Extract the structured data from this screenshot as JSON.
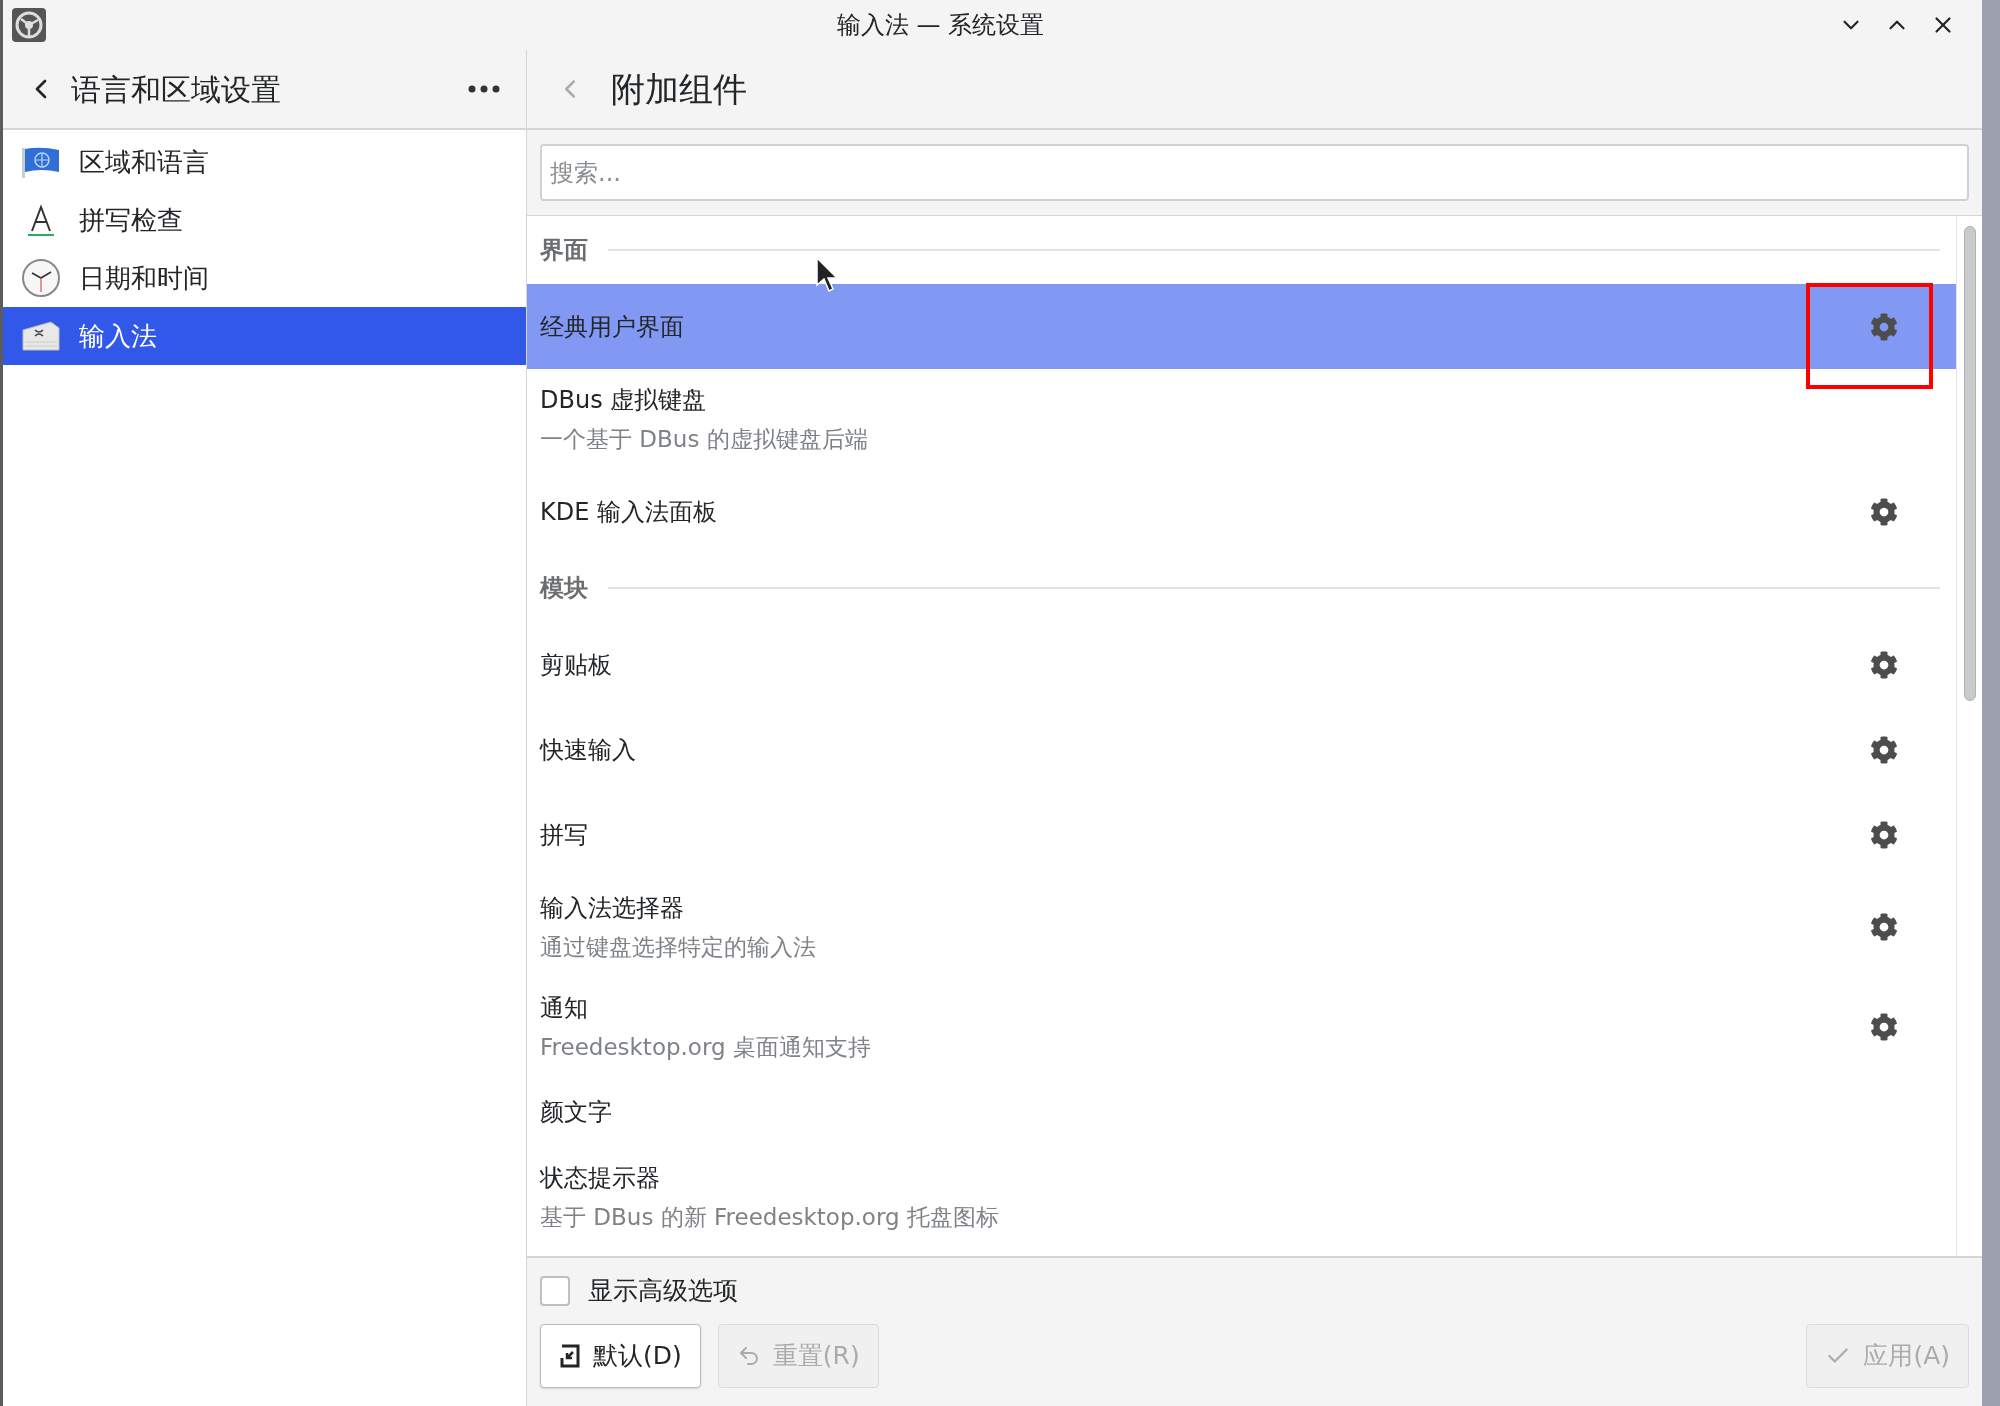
{
  "window": {
    "title": "输入法 — 系统设置"
  },
  "sidebar": {
    "title": "语言和区域设置",
    "items": [
      {
        "label": "区域和语言",
        "selected": false
      },
      {
        "label": "拼写检查",
        "selected": false
      },
      {
        "label": "日期和时间",
        "selected": false
      },
      {
        "label": "输入法",
        "selected": true
      }
    ]
  },
  "page": {
    "title": "附加组件",
    "search": {
      "placeholder": "搜索..."
    },
    "sections": [
      {
        "title": "界面",
        "addons": [
          {
            "name": "经典用户界面",
            "configurable": true,
            "selected": true
          },
          {
            "name": "DBus 虚拟键盘",
            "description": "一个基于 DBus 的虚拟键盘后端",
            "configurable": false,
            "selected": false
          },
          {
            "name": "KDE 输入法面板",
            "configurable": true,
            "selected": false
          }
        ]
      },
      {
        "title": "模块",
        "addons": [
          {
            "name": "剪贴板",
            "configurable": true,
            "selected": false
          },
          {
            "name": "快速输入",
            "configurable": true,
            "selected": false
          },
          {
            "name": "拼写",
            "configurable": true,
            "selected": false
          },
          {
            "name": "输入法选择器",
            "description": "通过键盘选择特定的输入法",
            "configurable": true,
            "selected": false
          },
          {
            "name": "通知",
            "description": "Freedesktop.org 桌面通知支持",
            "configurable": true,
            "selected": false
          },
          {
            "name": "颜文字",
            "configurable": false,
            "selected": false
          },
          {
            "name": "状态提示器",
            "description": "基于 DBus 的新 Freedesktop.org 托盘图标",
            "configurable": false,
            "selected": false
          }
        ]
      }
    ]
  },
  "footer": {
    "advanced": {
      "label": "显示高级选项",
      "checked": false
    },
    "buttons": [
      {
        "label": "默认(D)",
        "kind": "defaults",
        "disabled": false
      },
      {
        "label": "重置(R)",
        "kind": "reset",
        "disabled": true
      },
      {
        "label": "应用(A)",
        "kind": "apply",
        "disabled": true
      }
    ]
  }
}
